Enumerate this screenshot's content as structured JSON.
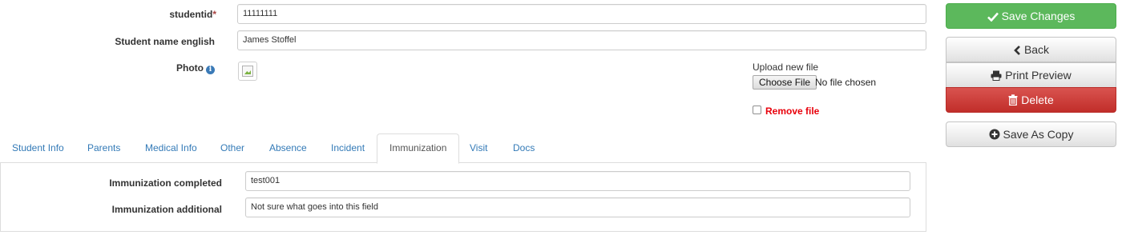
{
  "form": {
    "studentid": {
      "label": "studentid",
      "required_mark": "*",
      "value": "11111111"
    },
    "name_english": {
      "label": "Student name english",
      "value": "James Stoffel"
    },
    "photo": {
      "label": "Photo",
      "info_icon": "info-circle-icon",
      "upload_label": "Upload new file",
      "choose_button": "Choose File",
      "no_file_text": "No file chosen",
      "remove_label": "Remove file",
      "remove_checked": false
    }
  },
  "tabs": [
    {
      "label": "Student Info",
      "active": false
    },
    {
      "label": "Parents",
      "active": false
    },
    {
      "label": "Medical Info",
      "active": false
    },
    {
      "label": "Other",
      "active": false
    },
    {
      "label": "Absence",
      "active": false
    },
    {
      "label": "Incident",
      "active": false
    },
    {
      "label": "Immunization",
      "active": true
    },
    {
      "label": "Visit",
      "active": false
    },
    {
      "label": "Docs",
      "active": false
    }
  ],
  "immunization": {
    "completed": {
      "label": "Immunization completed",
      "value": "test001"
    },
    "additional": {
      "label": "Immunization additional",
      "value": "Not sure what goes into this field"
    }
  },
  "actions": {
    "save_changes": "Save Changes",
    "back": "Back",
    "print_preview": "Print Preview",
    "delete": "Delete",
    "save_as_copy": "Save As Copy"
  },
  "colors": {
    "success": "#5cb85c",
    "danger": "#d9534f",
    "link": "#337ab7",
    "required": "#a94442",
    "remove_label": "#e8000b"
  }
}
